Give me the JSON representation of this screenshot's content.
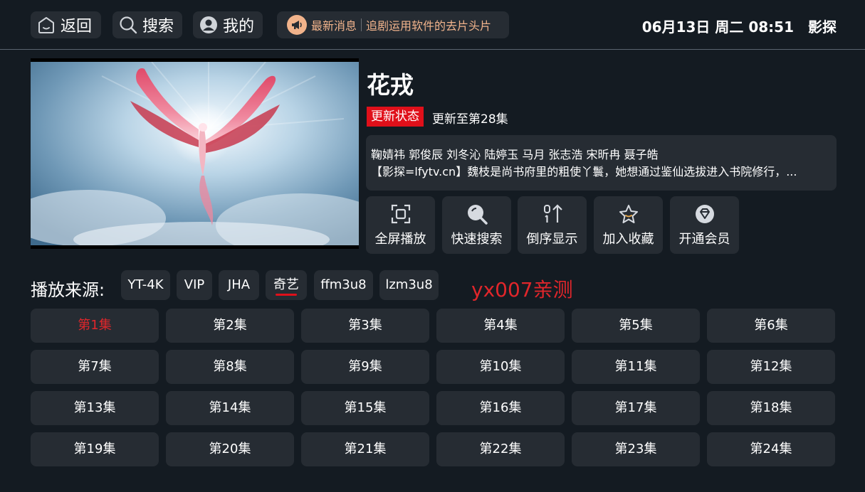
{
  "topbar": {
    "back_label": "返回",
    "search_label": "搜索",
    "me_label": "我的",
    "news_title": "最新消息",
    "news_text": "追剧运用软件的去片头片",
    "datetime": "06月13日 周二 08:51",
    "brand": "影探"
  },
  "detail": {
    "title": "花戎",
    "status_badge": "更新状态",
    "status_text": "更新至第28集",
    "cast": "鞠婧祎 郭俊辰 刘冬沁 陆婷玉 马月 张志浩 宋昕冉 聂子皓",
    "summary": "【影探=lfytv.cn】魏枝是尚书府里的粗使丫鬟，她想通过鉴仙选拔进入书院修行，..."
  },
  "actions": [
    {
      "label": "全屏播放",
      "icon": "fullscreen-icon"
    },
    {
      "label": "快速搜索",
      "icon": "search-icon"
    },
    {
      "label": "倒序显示",
      "icon": "sort-icon"
    },
    {
      "label": "加入收藏",
      "icon": "star-icon"
    },
    {
      "label": "开通会员",
      "icon": "diamond-icon"
    }
  ],
  "sources": {
    "label": "播放来源:",
    "items": [
      "YT-4K",
      "VIP",
      "JHA",
      "奇艺",
      "ffm3u8",
      "lzm3u8"
    ],
    "selected": "奇艺"
  },
  "watermark": "yx007亲测",
  "episodes": [
    "第1集",
    "第2集",
    "第3集",
    "第4集",
    "第5集",
    "第6集",
    "第7集",
    "第8集",
    "第9集",
    "第10集",
    "第11集",
    "第12集",
    "第13集",
    "第14集",
    "第15集",
    "第16集",
    "第17集",
    "第18集",
    "第19集",
    "第20集",
    "第21集",
    "第22集",
    "第23集",
    "第24集"
  ],
  "current_episode": "第1集",
  "colors": {
    "background": "#141b22",
    "panel": "#262c33",
    "accent_red": "#e0101a",
    "news_orange": "#f2b48c"
  }
}
